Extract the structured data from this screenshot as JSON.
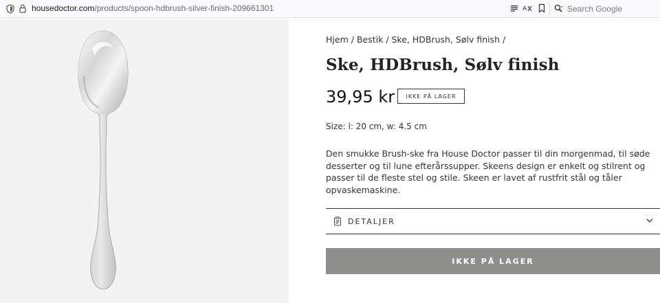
{
  "browser": {
    "url_host": "housedoctor.com",
    "url_path": "/products/spoon-hdbrush-silver-finish-209661301",
    "search_placeholder": "Search Google"
  },
  "product_image": {
    "icon": "spoon-image",
    "background": "#f3f3f3"
  },
  "breadcrumb": {
    "items": [
      "Hjem",
      "Bestik",
      "Ske, HDBrush, Sølv finish"
    ],
    "separator": "/"
  },
  "product": {
    "title": "Ske, HDBrush, Sølv finish",
    "price": "39,95 kr",
    "stock_badge": "IKKE PÅ LAGER",
    "size": "Size: l: 20 cm, w: 4.5 cm",
    "description": "Den smukke Brush-ske fra House Doctor passer til din morgenmad, til søde desserter og til lune efterårssupper. Skeens design er enkelt og stilrent og passer til de fleste stel og stile. Skeen er lavet af rustfrit stål og tåler opvaskemaskine."
  },
  "details": {
    "label": "DETALJER",
    "icon": "clipboard-icon",
    "toggle_icon": "chevron-down-icon"
  },
  "cta": {
    "label": "IKKE PÅ LAGER",
    "color": "#8e8e8c"
  }
}
